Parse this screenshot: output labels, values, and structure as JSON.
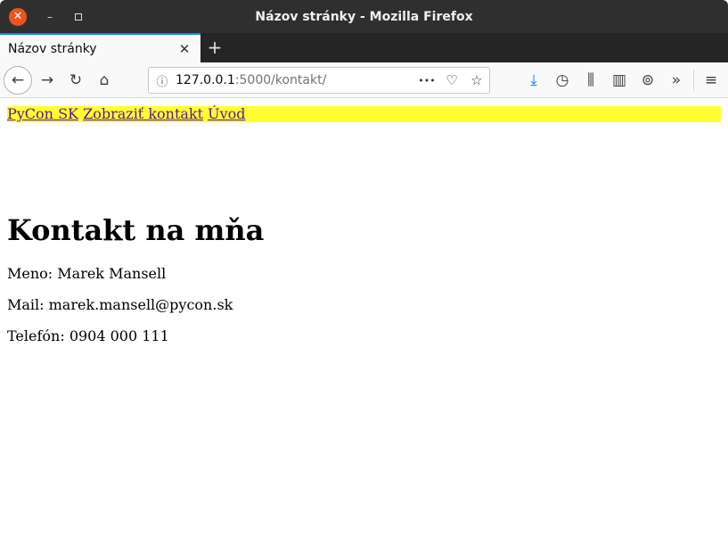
{
  "window": {
    "title": "Názov stránky - Mozilla Firefox",
    "close_glyph": "✕",
    "minimize_glyph": "–"
  },
  "tabs": [
    {
      "label": "Názov stránky",
      "close_glyph": "✕"
    }
  ],
  "new_tab_glyph": "+",
  "toolbar": {
    "back_glyph": "←",
    "forward_glyph": "→",
    "reload_glyph": "↻",
    "home_glyph": "⌂",
    "url_host": "127.0.0.1",
    "url_rest": ":5000/kontakt/",
    "info_glyph": "ⓘ",
    "more_glyph": "•••",
    "pocket_glyph": "♡",
    "bookmark_glyph": "☆",
    "download_glyph": "⤓",
    "history_glyph": "◷",
    "library_glyph": "⫼",
    "sidebar_glyph": "▥",
    "sync_glyph": "⊚",
    "overflow_glyph": "»",
    "menu_glyph": "≡",
    "accent_color": "#0a84ff"
  },
  "page": {
    "nav_links": [
      "PyCon SK",
      "Zobraziť kontakt",
      "Úvod"
    ],
    "heading": "Kontakt na mňa",
    "name_line": "Meno: Marek Mansell",
    "mail_line": "Mail: marek.mansell@pycon.sk",
    "phone_line": "Telefón: 0904 000 111",
    "nav_background": "#ffff33",
    "link_color": "#551a8b"
  }
}
